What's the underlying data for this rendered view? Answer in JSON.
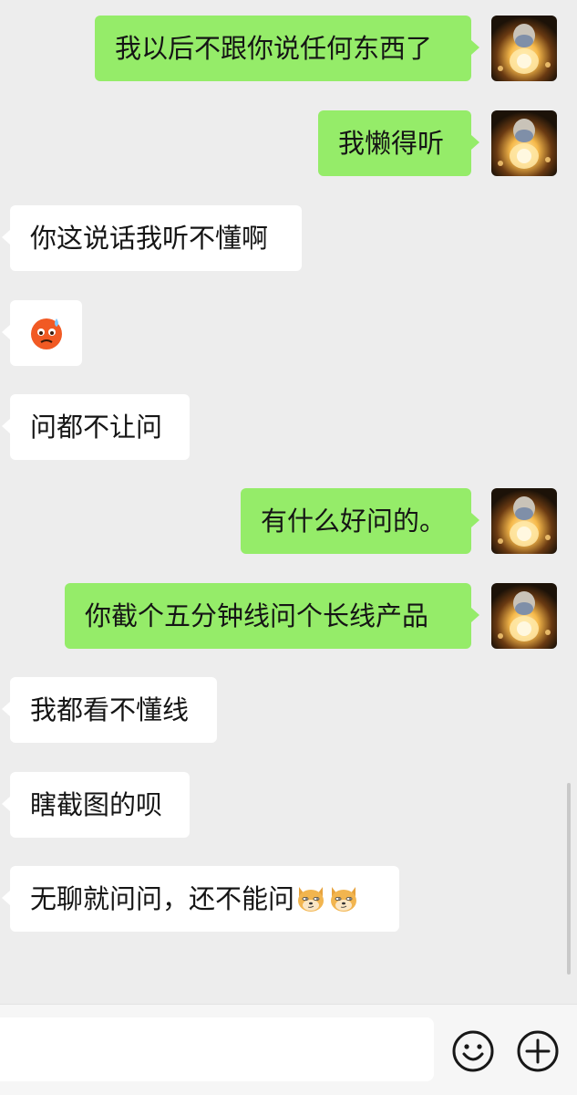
{
  "messages": [
    {
      "side": "out",
      "text": "我以后不跟你说任何东西了"
    },
    {
      "side": "out",
      "text": "我懒得听"
    },
    {
      "side": "in",
      "text": "你这说话我听不懂啊"
    },
    {
      "side": "in",
      "emoji": "cold-sweat-face-emoji"
    },
    {
      "side": "in",
      "text": "问都不让问"
    },
    {
      "side": "out",
      "text": "有什么好问的。"
    },
    {
      "side": "out",
      "text": "你截个五分钟线问个长线产品"
    },
    {
      "side": "in",
      "text": "我都看不懂线"
    },
    {
      "side": "in",
      "text": "瞎截图的呗"
    },
    {
      "side": "in",
      "text": "无聊就问问，还不能问",
      "trailing_emojis": [
        "doge-emoji",
        "doge-emoji"
      ]
    }
  ],
  "input_bar": {
    "text_value": "",
    "emoji_button_icon": "smiley-face-icon",
    "more_button_icon": "plus-circle-icon"
  },
  "colors": {
    "background": "#ededed",
    "outgoing_bubble": "#95ec69",
    "incoming_bubble": "#ffffff",
    "input_bar": "#f6f6f6"
  }
}
